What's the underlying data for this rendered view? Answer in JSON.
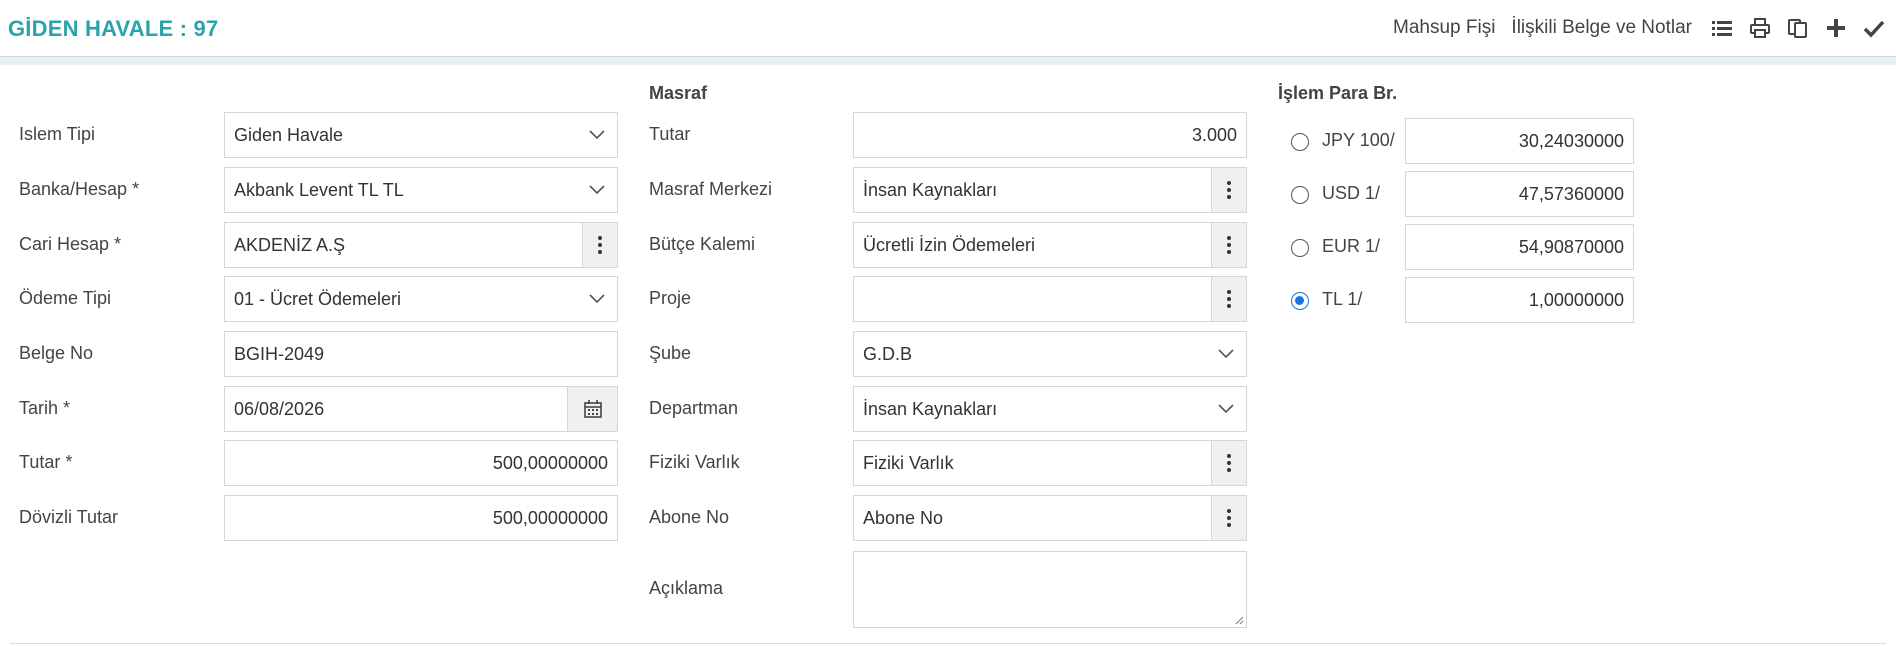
{
  "header": {
    "title": "GİDEN HAVALE : 97",
    "links": [
      "Mahsup Fişi",
      "İlişkili Belge ve Notlar"
    ],
    "icons": [
      "list-icon",
      "print-icon",
      "copy-icon",
      "plus-icon",
      "check-icon"
    ]
  },
  "left": {
    "islem_tipi": {
      "label": "Islem Tipi",
      "value": "Giden Havale"
    },
    "banka_hesap": {
      "label": "Banka/Hesap *",
      "value": "Akbank Levent TL TL"
    },
    "cari_hesap": {
      "label": "Cari Hesap *",
      "value": "AKDENİZ A.Ş"
    },
    "odeme_tipi": {
      "label": "Ödeme Tipi",
      "value": "01 - Ücret Ödemeleri"
    },
    "belge_no": {
      "label": "Belge No",
      "value": "BGIH-2049"
    },
    "tarih": {
      "label": "Tarih *",
      "value": "06/08/2026"
    },
    "tutar": {
      "label": "Tutar *",
      "value": "500,00000000"
    },
    "dovizli_tutar": {
      "label": "Dövizli Tutar",
      "value": "500,00000000"
    }
  },
  "masraf": {
    "section_title": "Masraf",
    "tutar": {
      "label": "Tutar",
      "value": "3.000"
    },
    "masraf_merkezi": {
      "label": "Masraf Merkezi",
      "value": "İnsan Kaynakları"
    },
    "butce_kalemi": {
      "label": "Bütçe Kalemi",
      "value": "Ücretli İzin Ödemeleri"
    },
    "proje": {
      "label": "Proje",
      "value": ""
    },
    "sube": {
      "label": "Şube",
      "value": "G.D.B"
    },
    "departman": {
      "label": "Departman",
      "value": "İnsan Kaynakları"
    },
    "fiziki_varlik": {
      "label": "Fiziki Varlık",
      "value": "Fiziki Varlık"
    },
    "abone_no": {
      "label": "Abone No",
      "value": "Abone No"
    },
    "aciklama": {
      "label": "Açıklama",
      "value": ""
    }
  },
  "currency": {
    "section_title": "İşlem Para Br.",
    "options": [
      {
        "label": "JPY 100/",
        "value": "30,24030000",
        "selected": false
      },
      {
        "label": "USD 1/",
        "value": "47,57360000",
        "selected": false
      },
      {
        "label": "EUR 1/",
        "value": "54,90870000",
        "selected": false
      },
      {
        "label": "TL 1/",
        "value": "1,00000000",
        "selected": true
      }
    ]
  },
  "colors": {
    "title": "#2aa3ac",
    "radio_selected": "#1a73e8"
  }
}
